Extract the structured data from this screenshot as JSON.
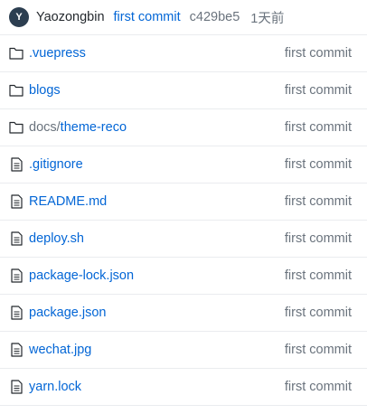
{
  "commit": {
    "avatar_letter": "Y",
    "author": "Yaozongbin",
    "message": "first commit",
    "sha": "c429be5",
    "time": "1天前"
  },
  "files": [
    {
      "type": "folder",
      "icon": "folder-icon",
      "prefix": "",
      "name": ".vuepress",
      "message": "first commit"
    },
    {
      "type": "folder",
      "icon": "folder-icon",
      "prefix": "",
      "name": "blogs",
      "message": "first commit"
    },
    {
      "type": "folder",
      "icon": "folder-icon",
      "prefix": "docs/",
      "name": "theme-reco",
      "message": "first commit"
    },
    {
      "type": "file",
      "icon": "file-icon",
      "prefix": "",
      "name": ".gitignore",
      "message": "first commit"
    },
    {
      "type": "file",
      "icon": "file-icon",
      "prefix": "",
      "name": "README.md",
      "message": "first commit"
    },
    {
      "type": "file",
      "icon": "file-icon",
      "prefix": "",
      "name": "deploy.sh",
      "message": "first commit"
    },
    {
      "type": "file",
      "icon": "file-icon",
      "prefix": "",
      "name": "package-lock.json",
      "message": "first commit"
    },
    {
      "type": "file",
      "icon": "file-icon",
      "prefix": "",
      "name": "package.json",
      "message": "first commit"
    },
    {
      "type": "file",
      "icon": "file-icon",
      "prefix": "",
      "name": "wechat.jpg",
      "message": "first commit"
    },
    {
      "type": "file",
      "icon": "file-icon",
      "prefix": "",
      "name": "yarn.lock",
      "message": "first commit"
    }
  ]
}
